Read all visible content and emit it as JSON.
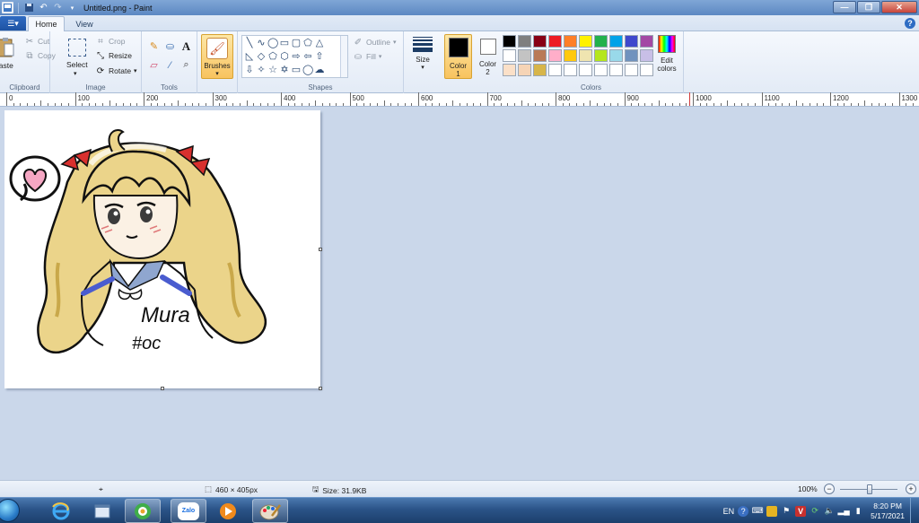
{
  "window": {
    "title": "Untitled.png - Paint",
    "controls": [
      "minimize",
      "restore",
      "close"
    ]
  },
  "tabs": [
    {
      "label": "Home",
      "active": true
    },
    {
      "label": "View",
      "active": false
    }
  ],
  "ribbon": {
    "clipboard": {
      "group_label": "Clipboard",
      "paste": "Paste",
      "cut": "Cut",
      "copy": "Copy"
    },
    "image": {
      "group_label": "Image",
      "select": "Select",
      "crop": "Crop",
      "resize": "Resize",
      "rotate": "Rotate"
    },
    "tools": {
      "group_label": "Tools"
    },
    "brushes": {
      "label": "Brushes"
    },
    "shapes": {
      "group_label": "Shapes",
      "outline": "Outline",
      "fill": "Fill"
    },
    "size": {
      "label": "Size"
    },
    "colors": {
      "group_label": "Colors",
      "color1_label": "Color",
      "color1_num": "1",
      "color2_label": "Color",
      "color2_num": "2",
      "color1": "#000000",
      "color2": "#ffffff",
      "edit": "Edit colors",
      "palette": [
        "#000000",
        "#7f7f7f",
        "#880015",
        "#ed1c24",
        "#ff7f27",
        "#fff200",
        "#22b14c",
        "#00a2e8",
        "#3f48cc",
        "#a349a4",
        "#ffffff",
        "#c3c3c3",
        "#b97a57",
        "#ffaec9",
        "#ffc90e",
        "#efe4b0",
        "#b5e61d",
        "#99d9ea",
        "#7092be",
        "#c8bfe7",
        "#fbe0c8",
        "#f6d4b6",
        "#d7b54a",
        "#ffffff",
        "#ffffff",
        "#ffffff",
        "#ffffff",
        "#ffffff",
        "#ffffff",
        "#ffffff"
      ]
    }
  },
  "ruler": {
    "labels": [
      "0",
      "100",
      "200",
      "300",
      "400",
      "500",
      "600",
      "700",
      "800",
      "900",
      "1000",
      "1100",
      "1200",
      "1300"
    ]
  },
  "canvas": {
    "drawing_text_1": "Mura",
    "drawing_text_2": "#oc"
  },
  "status": {
    "dimensions": "460 × 405px",
    "size": "Size: 31.9KB",
    "zoom": "100%"
  },
  "taskbar": {
    "apps": [
      "internet-explorer",
      "notepad",
      "green-app",
      "zalo",
      "media-player",
      "paint"
    ],
    "zalo_label": "Zalo",
    "tray": {
      "language": "EN",
      "time": "8:20 PM",
      "date": "5/17/2021"
    }
  }
}
